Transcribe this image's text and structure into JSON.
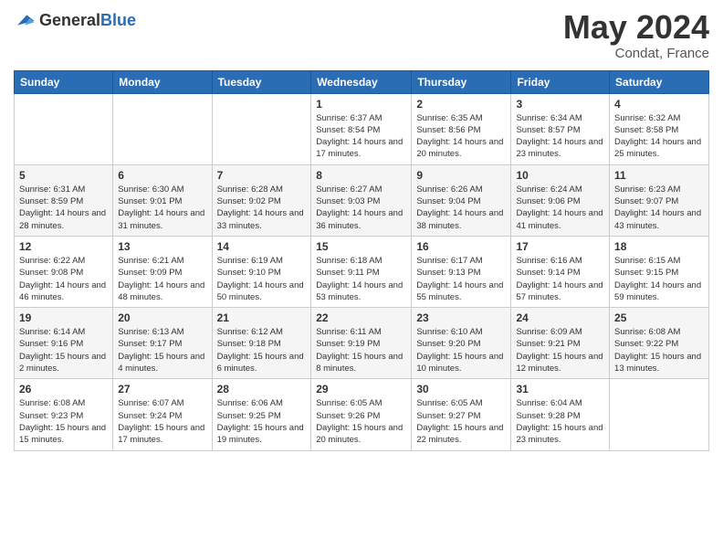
{
  "logo": {
    "general": "General",
    "blue": "Blue"
  },
  "header": {
    "month": "May 2024",
    "location": "Condat, France"
  },
  "weekdays": [
    "Sunday",
    "Monday",
    "Tuesday",
    "Wednesday",
    "Thursday",
    "Friday",
    "Saturday"
  ],
  "weeks": [
    [
      {
        "day": "",
        "sunrise": "",
        "sunset": "",
        "daylight": ""
      },
      {
        "day": "",
        "sunrise": "",
        "sunset": "",
        "daylight": ""
      },
      {
        "day": "",
        "sunrise": "",
        "sunset": "",
        "daylight": ""
      },
      {
        "day": "1",
        "sunrise": "Sunrise: 6:37 AM",
        "sunset": "Sunset: 8:54 PM",
        "daylight": "Daylight: 14 hours and 17 minutes."
      },
      {
        "day": "2",
        "sunrise": "Sunrise: 6:35 AM",
        "sunset": "Sunset: 8:56 PM",
        "daylight": "Daylight: 14 hours and 20 minutes."
      },
      {
        "day": "3",
        "sunrise": "Sunrise: 6:34 AM",
        "sunset": "Sunset: 8:57 PM",
        "daylight": "Daylight: 14 hours and 23 minutes."
      },
      {
        "day": "4",
        "sunrise": "Sunrise: 6:32 AM",
        "sunset": "Sunset: 8:58 PM",
        "daylight": "Daylight: 14 hours and 25 minutes."
      }
    ],
    [
      {
        "day": "5",
        "sunrise": "Sunrise: 6:31 AM",
        "sunset": "Sunset: 8:59 PM",
        "daylight": "Daylight: 14 hours and 28 minutes."
      },
      {
        "day": "6",
        "sunrise": "Sunrise: 6:30 AM",
        "sunset": "Sunset: 9:01 PM",
        "daylight": "Daylight: 14 hours and 31 minutes."
      },
      {
        "day": "7",
        "sunrise": "Sunrise: 6:28 AM",
        "sunset": "Sunset: 9:02 PM",
        "daylight": "Daylight: 14 hours and 33 minutes."
      },
      {
        "day": "8",
        "sunrise": "Sunrise: 6:27 AM",
        "sunset": "Sunset: 9:03 PM",
        "daylight": "Daylight: 14 hours and 36 minutes."
      },
      {
        "day": "9",
        "sunrise": "Sunrise: 6:26 AM",
        "sunset": "Sunset: 9:04 PM",
        "daylight": "Daylight: 14 hours and 38 minutes."
      },
      {
        "day": "10",
        "sunrise": "Sunrise: 6:24 AM",
        "sunset": "Sunset: 9:06 PM",
        "daylight": "Daylight: 14 hours and 41 minutes."
      },
      {
        "day": "11",
        "sunrise": "Sunrise: 6:23 AM",
        "sunset": "Sunset: 9:07 PM",
        "daylight": "Daylight: 14 hours and 43 minutes."
      }
    ],
    [
      {
        "day": "12",
        "sunrise": "Sunrise: 6:22 AM",
        "sunset": "Sunset: 9:08 PM",
        "daylight": "Daylight: 14 hours and 46 minutes."
      },
      {
        "day": "13",
        "sunrise": "Sunrise: 6:21 AM",
        "sunset": "Sunset: 9:09 PM",
        "daylight": "Daylight: 14 hours and 48 minutes."
      },
      {
        "day": "14",
        "sunrise": "Sunrise: 6:19 AM",
        "sunset": "Sunset: 9:10 PM",
        "daylight": "Daylight: 14 hours and 50 minutes."
      },
      {
        "day": "15",
        "sunrise": "Sunrise: 6:18 AM",
        "sunset": "Sunset: 9:11 PM",
        "daylight": "Daylight: 14 hours and 53 minutes."
      },
      {
        "day": "16",
        "sunrise": "Sunrise: 6:17 AM",
        "sunset": "Sunset: 9:13 PM",
        "daylight": "Daylight: 14 hours and 55 minutes."
      },
      {
        "day": "17",
        "sunrise": "Sunrise: 6:16 AM",
        "sunset": "Sunset: 9:14 PM",
        "daylight": "Daylight: 14 hours and 57 minutes."
      },
      {
        "day": "18",
        "sunrise": "Sunrise: 6:15 AM",
        "sunset": "Sunset: 9:15 PM",
        "daylight": "Daylight: 14 hours and 59 minutes."
      }
    ],
    [
      {
        "day": "19",
        "sunrise": "Sunrise: 6:14 AM",
        "sunset": "Sunset: 9:16 PM",
        "daylight": "Daylight: 15 hours and 2 minutes."
      },
      {
        "day": "20",
        "sunrise": "Sunrise: 6:13 AM",
        "sunset": "Sunset: 9:17 PM",
        "daylight": "Daylight: 15 hours and 4 minutes."
      },
      {
        "day": "21",
        "sunrise": "Sunrise: 6:12 AM",
        "sunset": "Sunset: 9:18 PM",
        "daylight": "Daylight: 15 hours and 6 minutes."
      },
      {
        "day": "22",
        "sunrise": "Sunrise: 6:11 AM",
        "sunset": "Sunset: 9:19 PM",
        "daylight": "Daylight: 15 hours and 8 minutes."
      },
      {
        "day": "23",
        "sunrise": "Sunrise: 6:10 AM",
        "sunset": "Sunset: 9:20 PM",
        "daylight": "Daylight: 15 hours and 10 minutes."
      },
      {
        "day": "24",
        "sunrise": "Sunrise: 6:09 AM",
        "sunset": "Sunset: 9:21 PM",
        "daylight": "Daylight: 15 hours and 12 minutes."
      },
      {
        "day": "25",
        "sunrise": "Sunrise: 6:08 AM",
        "sunset": "Sunset: 9:22 PM",
        "daylight": "Daylight: 15 hours and 13 minutes."
      }
    ],
    [
      {
        "day": "26",
        "sunrise": "Sunrise: 6:08 AM",
        "sunset": "Sunset: 9:23 PM",
        "daylight": "Daylight: 15 hours and 15 minutes."
      },
      {
        "day": "27",
        "sunrise": "Sunrise: 6:07 AM",
        "sunset": "Sunset: 9:24 PM",
        "daylight": "Daylight: 15 hours and 17 minutes."
      },
      {
        "day": "28",
        "sunrise": "Sunrise: 6:06 AM",
        "sunset": "Sunset: 9:25 PM",
        "daylight": "Daylight: 15 hours and 19 minutes."
      },
      {
        "day": "29",
        "sunrise": "Sunrise: 6:05 AM",
        "sunset": "Sunset: 9:26 PM",
        "daylight": "Daylight: 15 hours and 20 minutes."
      },
      {
        "day": "30",
        "sunrise": "Sunrise: 6:05 AM",
        "sunset": "Sunset: 9:27 PM",
        "daylight": "Daylight: 15 hours and 22 minutes."
      },
      {
        "day": "31",
        "sunrise": "Sunrise: 6:04 AM",
        "sunset": "Sunset: 9:28 PM",
        "daylight": "Daylight: 15 hours and 23 minutes."
      },
      {
        "day": "",
        "sunrise": "",
        "sunset": "",
        "daylight": ""
      }
    ]
  ]
}
